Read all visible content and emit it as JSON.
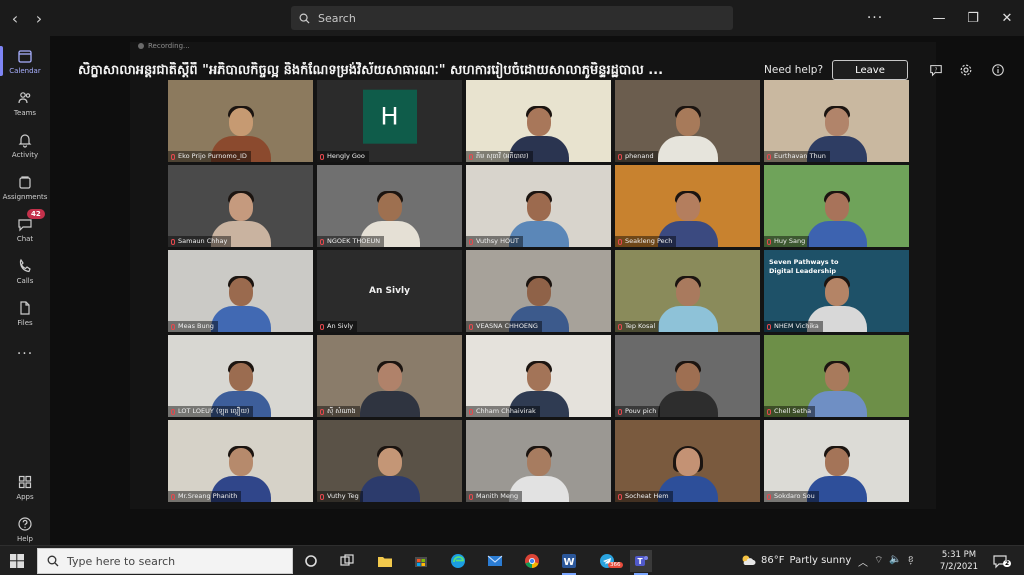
{
  "titlebar": {
    "search_label": "Search"
  },
  "rail": {
    "items": [
      {
        "label": "Calendar",
        "icon": "calendar-icon",
        "active": true
      },
      {
        "label": "Teams",
        "icon": "teams-icon"
      },
      {
        "label": "Activity",
        "icon": "bell-icon"
      },
      {
        "label": "Assignments",
        "icon": "assignments-icon"
      },
      {
        "label": "Chat",
        "icon": "chat-icon",
        "badge": "42"
      },
      {
        "label": "Calls",
        "icon": "phone-icon"
      },
      {
        "label": "Files",
        "icon": "files-icon"
      }
    ],
    "more": "...",
    "apps_label": "Apps",
    "help_label": "Help"
  },
  "meeting": {
    "recording_label": "Recording...",
    "title": "សិក្ខាសាលាអន្តរជាតិស្តីពី \"អភិបាលកិច្ចល្អ និងកំណែទម្រង់វិស័យសាធារណៈ\" សហការរៀបចំដោយសាលាភូមិន្ទរដ្ឋបាល ...",
    "need_help": "Need help?",
    "leave_label": "Leave"
  },
  "participants": [
    {
      "name": "Eko Prijo Purnomo_ID",
      "scene": "#8c7a5e",
      "body": "#8b4a2e",
      "head": "#c69a72"
    },
    {
      "name": "Hengly Goo",
      "avatar": "H",
      "scene": "#2b2b2b"
    },
    {
      "name": "ភីម សុធាវី (អភិបាល)",
      "scene": "#e8e3cf",
      "body": "#2a3450",
      "head": "#a8775a",
      "pinned": true
    },
    {
      "name": "phenand",
      "scene": "#6b5d4e",
      "body": "#e6e4dc",
      "head": "#a77a5a"
    },
    {
      "name": "Eurthavan Thun",
      "scene": "#c9b8a0",
      "body": "#2e3d63",
      "head": "#b1846a"
    },
    {
      "name": "Samaun Chhay",
      "scene": "#4a4a4a",
      "body": "#c9b3a0",
      "head": "#c59a7e"
    },
    {
      "name": "NGOEK THOEUN",
      "scene": "#707070",
      "body": "#e5e0d5",
      "head": "#9e7050"
    },
    {
      "name": "Vuthsy HOUT",
      "scene": "#d8d4cc",
      "body": "#5b87b8",
      "head": "#9c6a4e"
    },
    {
      "name": "Seakleng Pech",
      "scene": "#c8822f",
      "body": "#3b4a80",
      "head": "#b47e5e"
    },
    {
      "name": "Huy Sang",
      "scene": "#6fa35a",
      "body": "#3d63b0",
      "head": "#a8735a"
    },
    {
      "name": "Meas Bung",
      "scene": "#cbcac6",
      "body": "#4169b3",
      "head": "#9a6a4e"
    },
    {
      "name": "An Sivly",
      "text_only": "An Sivly",
      "scene": "#2b2b2b"
    },
    {
      "name": "VEASNA CHHOENG",
      "scene": "#a7a29a",
      "body": "#3c5a8c",
      "head": "#8f6248"
    },
    {
      "name": "Tep Kosal",
      "scene": "#8a8b5b",
      "body": "#8ec2d8",
      "head": "#a97a5e"
    },
    {
      "name": "NHEM Vichika",
      "scene": "#1e5168",
      "body": "#d8d8d8",
      "head": "#b48466",
      "slide": "Seven Pathways to Digital Leadership"
    },
    {
      "name": "LOT LOEUY (ឡុត ល្អឿយ)",
      "scene": "#d8d7d2",
      "body": "#3d5e9a",
      "head": "#9b6c50"
    },
    {
      "name": "ស៊ី សំណាង",
      "scene": "#8a7c6a",
      "body": "#2f3440",
      "head": "#b0826a"
    },
    {
      "name": "Chham Chhaivirak",
      "scene": "#e5e2dc",
      "body": "#2f3b52",
      "head": "#a37458"
    },
    {
      "name": "Pouv pich",
      "scene": "#6a6a6a",
      "body": "#2d2d2d",
      "head": "#9e6f52"
    },
    {
      "name": "Chell Setha",
      "scene": "#6d8f48",
      "body": "#6f8fc4",
      "head": "#a87a5c"
    },
    {
      "name": "Mr.Sreang Phanith",
      "scene": "#d6d2c8",
      "body": "#30468a",
      "head": "#b68a6c"
    },
    {
      "name": "Vuthy Teg",
      "scene": "#5a5247",
      "body": "#2c3b6c",
      "head": "#c49676"
    },
    {
      "name": "Manith Meng",
      "scene": "#9b9893",
      "body": "#e2e2e2",
      "head": "#a77c60"
    },
    {
      "name": "Socheat Hem",
      "scene": "#7a5a3e",
      "body": "#2d4f9a",
      "head": "#c49274",
      "hair_long": true
    },
    {
      "name": "Sokdaro Sou",
      "scene": "#dcdbd6",
      "body": "#2e4f9a",
      "head": "#a47458"
    }
  ],
  "taskbar": {
    "search_placeholder": "Type here to search",
    "weather_temp": "86°F",
    "weather_desc": "Partly sunny",
    "time": "5:31 PM",
    "date": "7/2/2021",
    "telegram_badge": "366",
    "notify_count": "2"
  }
}
